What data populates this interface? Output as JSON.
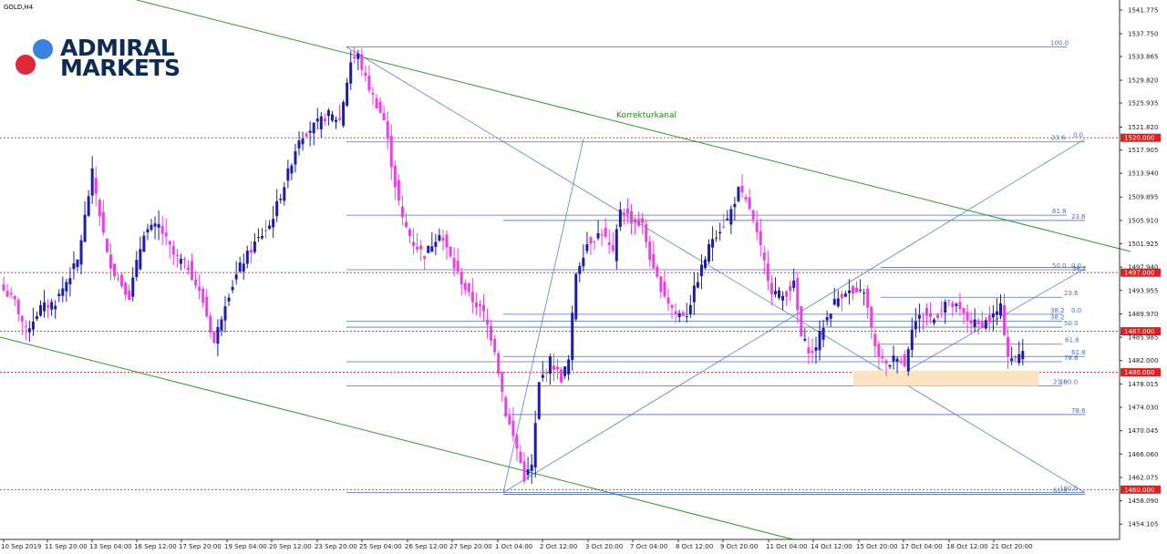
{
  "symbol": "GOLD,H4",
  "brand": {
    "line1": "ADMIRAL",
    "line2": "MARKETS",
    "dot_blue": "#3b82e0",
    "dot_red": "#e0283a",
    "text_color": "#0c2c55"
  },
  "annotation": "Korrekturkanal",
  "colors": {
    "bull": "#1d1dab",
    "bear": "#ee3ee8",
    "fib": "#4a6fd1",
    "channel": "#2e9a2e",
    "level": "#e02020",
    "zone": "#fde3c2"
  },
  "chart_data": {
    "type": "candlestick",
    "title": "GOLD,H4",
    "ylim": [
      1451.5,
      1543.5
    ],
    "y_ticks": [
      "1541.775",
      "1537.750",
      "1533.865",
      "1529.820",
      "1525.935",
      "1521.820",
      "1517.905",
      "1513.940",
      "1509.895",
      "1505.910",
      "1501.925",
      "1497.940",
      "1493.955",
      "1489.970",
      "1485.985",
      "1482.000",
      "1478.015",
      "1474.030",
      "1470.045",
      "1466.060",
      "1462.075",
      "1458.090",
      "1454.105"
    ],
    "x_labels": [
      "10 Sep 2019",
      "11 Sep 20:00",
      "13 Sep 04:00",
      "16 Sep 12:00",
      "17 Sep 20:00",
      "19 Sep 04:00",
      "20 Sep 12:00",
      "23 Sep 20:00",
      "25 Sep 04:00",
      "26 Sep 12:00",
      "27 Sep 20:00",
      "1 Oct 04:00",
      "2 Oct 12:00",
      "3 Oct 20:00",
      "7 Oct 04:00",
      "8 Oct 12:00",
      "9 Oct 20:00",
      "11 Oct 04:00",
      "14 Oct 12:00",
      "15 Oct 20:00",
      "17 Oct 04:00",
      "18 Oct 12:00",
      "21 Oct 20:00"
    ],
    "key_levels": [
      "1520.000",
      "1497.000",
      "1487.000",
      "1480.000",
      "1460.000"
    ],
    "fib_labels": [
      {
        "text": "100.0",
        "price": 1535.5
      },
      {
        "text": "23.6",
        "price": 1519.3
      },
      {
        "text": "0.0",
        "price": 1519.8
      },
      {
        "text": "61.8",
        "price": 1506.8
      },
      {
        "text": "23.6",
        "price": 1505.9
      },
      {
        "text": "50.0",
        "price": 1497.5
      },
      {
        "text": "0.0",
        "price": 1497.5
      },
      {
        "text": "38.2",
        "price": 1497.0
      },
      {
        "text": "23.6",
        "price": 1492.8
      },
      {
        "text": "38.2",
        "price": 1489.9
      },
      {
        "text": "0.0",
        "price": 1489.9
      },
      {
        "text": "38.2",
        "price": 1488.7
      },
      {
        "text": "50.0",
        "price": 1487.7
      },
      {
        "text": "61.8",
        "price": 1484.8
      },
      {
        "text": "61.8",
        "price": 1482.7
      },
      {
        "text": "78.6",
        "price": 1481.8
      },
      {
        "text": "23.6",
        "price": 1477.7
      },
      {
        "text": "100.0",
        "price": 1477.7
      },
      {
        "text": "78.6",
        "price": 1472.8
      },
      {
        "text": "100.0",
        "price": 1459.5
      },
      {
        "text": "61.8",
        "price": 1459.2
      }
    ],
    "waypoints": [
      [
        0,
        1494
      ],
      [
        3,
        1492
      ],
      [
        6,
        1487
      ],
      [
        10,
        1491
      ],
      [
        14,
        1492
      ],
      [
        20,
        1499
      ],
      [
        24,
        1514
      ],
      [
        28,
        1500
      ],
      [
        30,
        1497
      ],
      [
        34,
        1493
      ],
      [
        38,
        1504
      ],
      [
        42,
        1505
      ],
      [
        46,
        1500
      ],
      [
        50,
        1498
      ],
      [
        54,
        1492
      ],
      [
        57,
        1485
      ],
      [
        60,
        1492
      ],
      [
        64,
        1498
      ],
      [
        68,
        1502
      ],
      [
        72,
        1505
      ],
      [
        76,
        1512
      ],
      [
        80,
        1520
      ],
      [
        84,
        1522
      ],
      [
        88,
        1524
      ],
      [
        91,
        1523
      ],
      [
        94,
        1533
      ],
      [
        96,
        1534
      ],
      [
        98,
        1530
      ],
      [
        100,
        1527
      ],
      [
        103,
        1523
      ],
      [
        106,
        1512
      ],
      [
        108,
        1506
      ],
      [
        111,
        1502
      ],
      [
        114,
        1500
      ],
      [
        118,
        1504
      ],
      [
        122,
        1498
      ],
      [
        126,
        1493
      ],
      [
        130,
        1490
      ],
      [
        133,
        1484
      ],
      [
        136,
        1473
      ],
      [
        139,
        1467
      ],
      [
        141,
        1462
      ],
      [
        143,
        1464
      ],
      [
        145,
        1478
      ],
      [
        148,
        1482
      ],
      [
        151,
        1479
      ],
      [
        153,
        1482
      ],
      [
        155,
        1497
      ],
      [
        158,
        1502
      ],
      [
        162,
        1504
      ],
      [
        165,
        1500
      ],
      [
        167,
        1508
      ],
      [
        170,
        1506
      ],
      [
        173,
        1505
      ],
      [
        176,
        1497
      ],
      [
        180,
        1492
      ],
      [
        182,
        1490
      ],
      [
        185,
        1490
      ],
      [
        188,
        1496
      ],
      [
        192,
        1503
      ],
      [
        196,
        1506
      ],
      [
        199,
        1511
      ],
      [
        202,
        1508
      ],
      [
        205,
        1501
      ],
      [
        208,
        1494
      ],
      [
        211,
        1493
      ],
      [
        214,
        1495
      ],
      [
        216,
        1486
      ],
      [
        219,
        1483
      ],
      [
        222,
        1488
      ],
      [
        225,
        1492
      ],
      [
        228,
        1494
      ],
      [
        231,
        1493
      ],
      [
        233,
        1494
      ],
      [
        236,
        1484
      ],
      [
        239,
        1481
      ],
      [
        242,
        1483
      ],
      [
        244,
        1481
      ],
      [
        246,
        1488
      ],
      [
        249,
        1490
      ],
      [
        252,
        1489
      ],
      [
        255,
        1492
      ],
      [
        258,
        1491
      ],
      [
        261,
        1489
      ],
      [
        264,
        1488
      ],
      [
        267,
        1489
      ],
      [
        270,
        1491
      ],
      [
        272,
        1483
      ],
      [
        274,
        1482
      ],
      [
        276,
        1484
      ]
    ]
  }
}
